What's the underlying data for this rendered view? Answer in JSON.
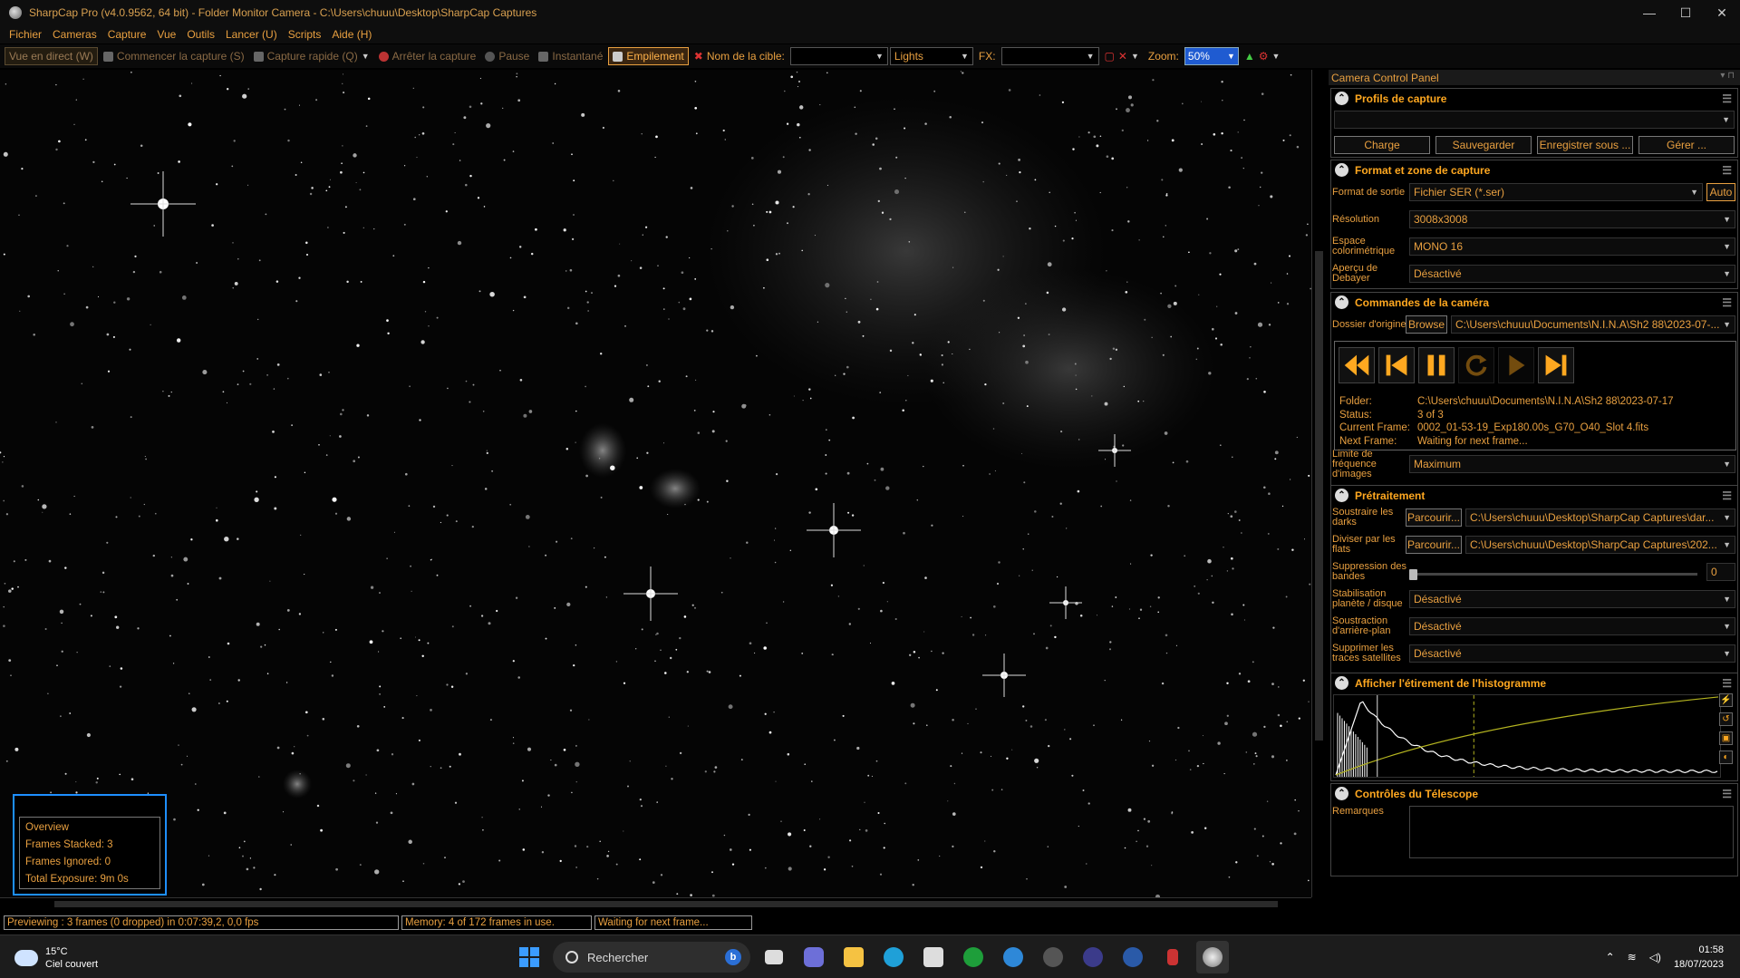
{
  "window": {
    "title": "SharpCap Pro (v4.0.9562, 64 bit) - Folder Monitor Camera - C:\\Users\\chuuu\\Desktop\\SharpCap Captures",
    "minimize": "—",
    "maximize": "☐",
    "close": "✕"
  },
  "menu": [
    "Fichier",
    "Cameras",
    "Capture",
    "Vue",
    "Outils",
    "Lancer (U)",
    "Scripts",
    "Aide (H)"
  ],
  "toolbar": {
    "live": "Vue en direct (W)",
    "start": "Commencer la capture (S)",
    "quick": "Capture rapide (Q)",
    "stop": "Arrêter la capture",
    "pause": "Pause",
    "snapshot": "Instantané",
    "stacking": "Empilement",
    "target_label": "Nom de la cible:",
    "target_value": "",
    "frame_type": "Lights",
    "fx_label": "FX:",
    "fx_value": "",
    "zoom_label": "Zoom:",
    "zoom_value": "50%"
  },
  "overview": {
    "title": "Overview",
    "frames_stacked": "Frames Stacked: 3",
    "frames_ignored": "Frames Ignored: 0",
    "total_exposure": "Total Exposure:   9m 0s"
  },
  "status": {
    "preview": "Previewing : 3 frames (0 dropped) in 0:07:39,2, 0,0 fps",
    "memory": "Memory: 4 of 172 frames in use.",
    "waiting": "Waiting for next frame..."
  },
  "panel": {
    "title": "Camera Control Panel",
    "profiles": {
      "title": "Profils de capture",
      "value": "",
      "charge": "Charge",
      "save": "Sauvegarder",
      "save_as": "Enregistrer sous ...",
      "manage": "Gérer ..."
    },
    "format": {
      "title": "Format et zone de capture",
      "output_label": "Format de sortie",
      "output_value": "Fichier SER (*.ser)",
      "auto": "Auto",
      "res_label": "Résolution",
      "res_value": "3008x3008",
      "color_label": "Espace colorimétrique",
      "color_value": "MONO 16",
      "debayer_label": "Aperçu de Debayer",
      "debayer_value": "Désactivé"
    },
    "camera": {
      "title": "Commandes de la caméra",
      "folder_label": "Dossier d'origine",
      "browse": "Browse",
      "folder_value": "C:\\Users\\chuuu\\Documents\\N.I.N.A\\Sh2 88\\2023-07-...",
      "folder_k": "Folder:",
      "folder_v": "C:\\Users\\chuuu\\Documents\\N.I.N.A\\Sh2 88\\2023-07-17",
      "status_k": "Status:",
      "status_v": "3 of 3",
      "current_k": "Current Frame:",
      "current_v": "0002_01-53-19_Exp180.00s_G70_O40_Slot 4.fits",
      "next_k": "Next Frame:",
      "next_v": "Waiting for next frame...",
      "rate_label": "Limite de fréquence d'images",
      "rate_value": "Maximum"
    },
    "preproc": {
      "title": "Prétraitement",
      "darks_label": "Soustraire les darks",
      "darks_btn": "Parcourir...",
      "darks_value": "C:\\Users\\chuuu\\Desktop\\SharpCap Captures\\dar...",
      "flats_label": "Diviser par les flats",
      "flats_btn": "Parcourir...",
      "flats_value": "C:\\Users\\chuuu\\Desktop\\SharpCap Captures\\202...",
      "banding_label": "Suppression des bandes",
      "banding_value": "0",
      "banding_level": 0,
      "stab_label": "Stabilisation planète / disque",
      "stab_value": "Désactivé",
      "bg_label": "Soustraction d'arrière-plan",
      "bg_value": "Désactivé",
      "sat_label": "Supprimer les traces satellites",
      "sat_value": "Désactivé"
    },
    "histogram": {
      "title": "Afficher l'étirement de l'histogramme"
    },
    "telescope": {
      "title": "Contrôles du Télescope",
      "remarks_label": "Remarques",
      "remarks_value": ""
    }
  },
  "taskbar": {
    "temp": "15°C",
    "weather": "Ciel couvert",
    "search": "Rechercher",
    "time": "01:58",
    "date": "18/07/2023"
  },
  "colors": {
    "accent": "#e9a040",
    "highlight": "#ffa820",
    "zoom_bg": "#1f5bd1",
    "overview_border": "#1e8fff"
  }
}
